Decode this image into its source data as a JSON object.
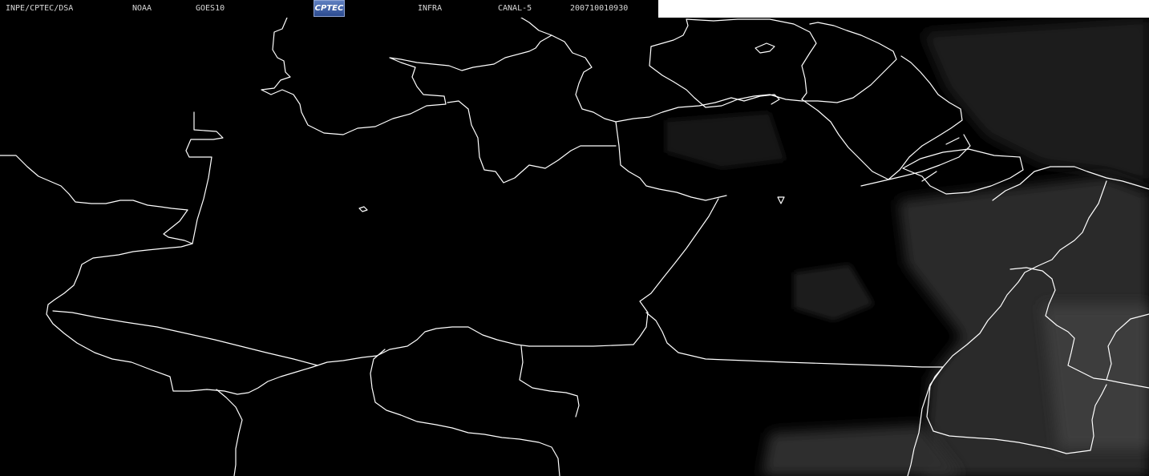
{
  "header": {
    "institution": "INPE/CPTEC/DSA",
    "agency": "NOAA",
    "satellite": "GOES10",
    "logo_text": "CPTEC",
    "product": "INFRA",
    "channel": "CANAL-5",
    "timestamp": "200710010930"
  },
  "colors": {
    "background": "#000000",
    "border_lines": "#ffffff",
    "header_text": "#d8d8d8",
    "cloud_gray": "#3a3a3a"
  },
  "map": {
    "type": "satellite infrared image with state boundaries",
    "border_icon": "state-boundary-lines"
  }
}
